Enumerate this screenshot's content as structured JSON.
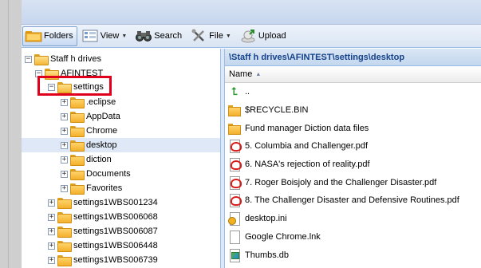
{
  "toolbar": {
    "folders_label": "Folders",
    "view_label": "View",
    "search_label": "Search",
    "file_label": "File",
    "upload_label": "Upload"
  },
  "tree": {
    "items": [
      {
        "label": "Staff h drives",
        "level": 0,
        "expander": "−",
        "open": true
      },
      {
        "label": "AFINTEST",
        "level": 1,
        "expander": "−",
        "open": true
      },
      {
        "label": "settings",
        "level": 2,
        "expander": "−",
        "open": true
      },
      {
        "label": ".eclipse",
        "level": 3,
        "expander": "+"
      },
      {
        "label": "AppData",
        "level": 3,
        "expander": "+"
      },
      {
        "label": "Chrome",
        "level": 3,
        "expander": "+"
      },
      {
        "label": "desktop",
        "level": 3,
        "expander": "+",
        "selected": true
      },
      {
        "label": "diction",
        "level": 3,
        "expander": "+"
      },
      {
        "label": "Documents",
        "level": 3,
        "expander": "+"
      },
      {
        "label": "Favorites",
        "level": 3,
        "expander": "+"
      },
      {
        "label": "settings1WBS001234",
        "level": 2,
        "expander": "+"
      },
      {
        "label": "settings1WBS006068",
        "level": 2,
        "expander": "+"
      },
      {
        "label": "settings1WBS006087",
        "level": 2,
        "expander": "+"
      },
      {
        "label": "settings1WBS006448",
        "level": 2,
        "expander": "+"
      },
      {
        "label": "settings1WBS006739",
        "level": 2,
        "expander": "+"
      }
    ]
  },
  "files": {
    "path": "\\Staff h drives\\AFINTEST\\settings\\desktop",
    "column_name": "Name",
    "rows": [
      {
        "name": "..",
        "icon": "up-arrow-icon"
      },
      {
        "name": "$RECYCLE.BIN",
        "icon": "folder-icon"
      },
      {
        "name": "Fund manager Diction data files",
        "icon": "folder-icon"
      },
      {
        "name": "5. Columbia and Challenger.pdf",
        "icon": "pdf-icon"
      },
      {
        "name": "6. NASA's rejection of reality.pdf",
        "icon": "pdf-icon"
      },
      {
        "name": "7. Roger Boisjoly and the Challenger Disaster.pdf",
        "icon": "pdf-icon"
      },
      {
        "name": "8. The Challenger Disaster and Defensive Routines.pdf",
        "icon": "pdf-icon"
      },
      {
        "name": "desktop.ini",
        "icon": "settings-file-icon"
      },
      {
        "name": "Google Chrome.lnk",
        "icon": "document-icon"
      },
      {
        "name": "Thumbs.db",
        "icon": "database-file-icon"
      }
    ]
  },
  "colors": {
    "accent": "#99bbe8",
    "path_text": "#15428b",
    "highlight": "#e0001b"
  }
}
